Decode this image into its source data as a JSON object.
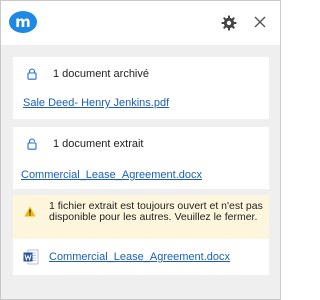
{
  "header": {
    "logo_letter": "m",
    "settings_icon": "gear-icon",
    "close_icon": "close-icon"
  },
  "archived": {
    "status": "1 document archivé",
    "document": "Sale Deed- Henry Jenkins.pdf"
  },
  "extracted": {
    "status": "1 document extrait",
    "document": "Commercial_Lease_Agreement.docx"
  },
  "warning": {
    "message": "1 fichier extrait est toujours ouvert et n'est pas disponible pour les autres. Veuillez le fermer.",
    "document": "Commercial_Lease_Agreement.docx"
  },
  "colors": {
    "brand": "#1e88e5",
    "link": "#1a5fb4",
    "warning_bg": "#fdf6dc"
  }
}
